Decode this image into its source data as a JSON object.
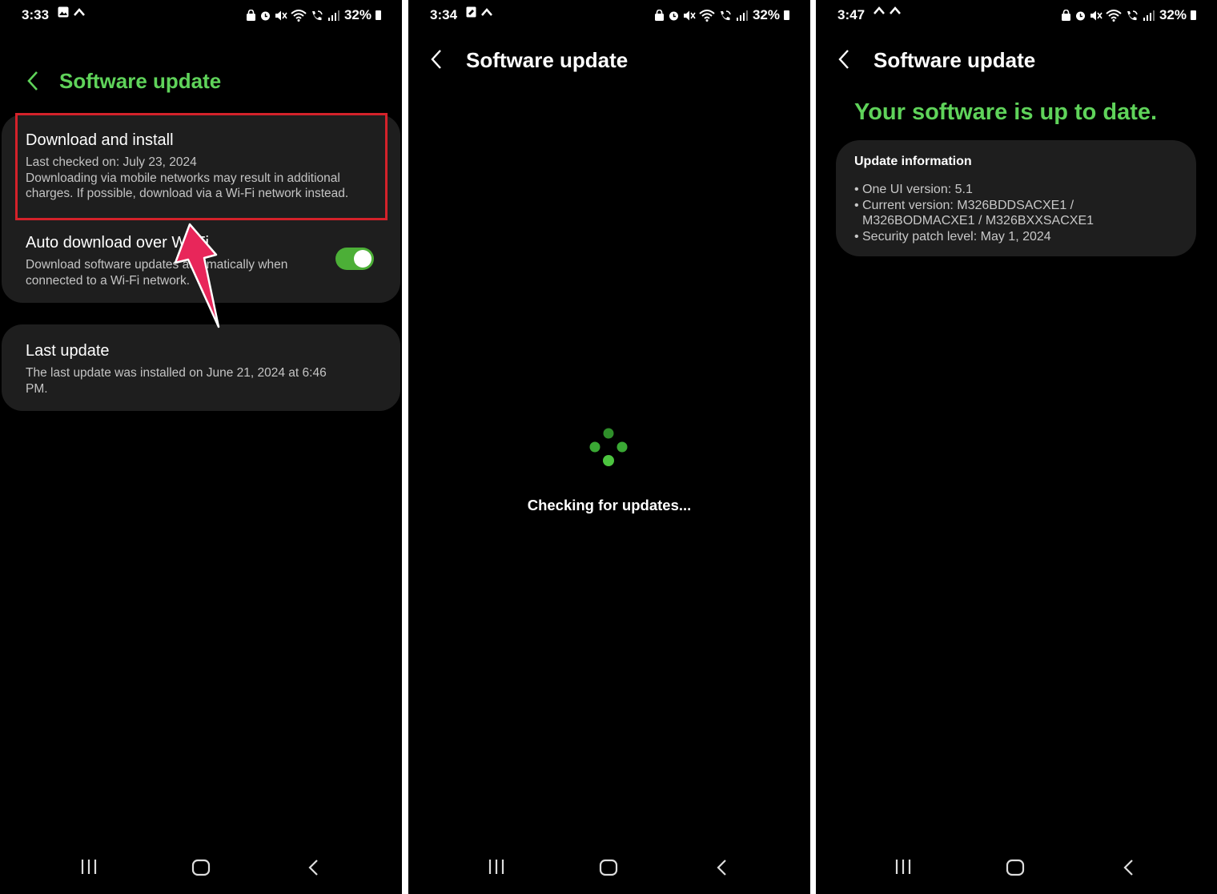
{
  "screen1": {
    "status": {
      "time": "3:33",
      "battery": "32%"
    },
    "title": "Software update",
    "download": {
      "title": "Download and install",
      "sub_line1": "Last checked on: July 23, 2024",
      "sub_line2": "Downloading via mobile networks may result in additional",
      "sub_line3": "charges. If possible, download via a Wi-Fi network instead."
    },
    "auto": {
      "title": "Auto download over Wi-Fi",
      "sub_line1": "Download software updates automatically when",
      "sub_line2": "connected to a Wi-Fi network.",
      "enabled": true
    },
    "last_update": {
      "title": "Last update",
      "sub_line1": "The last update was installed on June 21, 2024 at 6:46",
      "sub_line2": "PM."
    }
  },
  "screen2": {
    "status": {
      "time": "3:34",
      "battery": "32%"
    },
    "title": "Software update",
    "checking": "Checking for updates..."
  },
  "screen3": {
    "status": {
      "time": "3:47",
      "battery": "32%"
    },
    "title": "Software update",
    "headline": "Your software is up to date.",
    "info": {
      "title": "Update information",
      "line1": "One UI version: 5.1",
      "line2": "Current version: M326BDDSACXE1 /",
      "line2b": "M326BODMACXE1 / M326BXXSACXE1",
      "line3": "Security patch level: May 1, 2024"
    }
  },
  "colors": {
    "accent_green": "#5fd35a",
    "highlight_red": "#d4222a",
    "arrow_pink": "#e8265a"
  },
  "icons": [
    "back-arrow-icon",
    "recent-apps-icon",
    "home-icon",
    "nav-back-icon",
    "wifi-icon",
    "signal-icon",
    "alarm-icon",
    "mute-icon",
    "battery-icon",
    "loading-spinner-icon",
    "pointer-arrow-icon"
  ]
}
